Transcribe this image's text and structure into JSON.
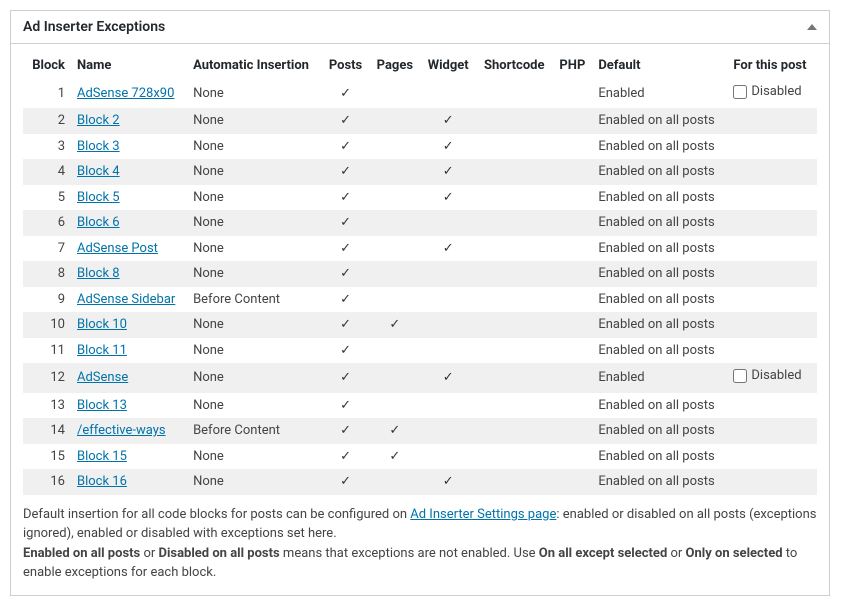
{
  "panel": {
    "title": "Ad Inserter Exceptions"
  },
  "columns": {
    "block": "Block",
    "name": "Name",
    "automatic": "Automatic Insertion",
    "posts": "Posts",
    "pages": "Pages",
    "widget": "Widget",
    "shortcode": "Shortcode",
    "php": "PHP",
    "default": "Default",
    "forpost": "For this post"
  },
  "check": "✓",
  "rows": [
    {
      "n": "1",
      "name": "AdSense 728x90",
      "auto": "None",
      "posts": true,
      "pages": false,
      "widget": false,
      "shortcode": false,
      "php": false,
      "default": "Enabled",
      "disabled": true,
      "disabled_label": "Disabled"
    },
    {
      "n": "2",
      "name": "Block 2",
      "auto": "None",
      "posts": true,
      "pages": false,
      "widget": true,
      "shortcode": false,
      "php": false,
      "default": "Enabled on all posts"
    },
    {
      "n": "3",
      "name": "Block 3",
      "auto": "None",
      "posts": true,
      "pages": false,
      "widget": true,
      "shortcode": false,
      "php": false,
      "default": "Enabled on all posts"
    },
    {
      "n": "4",
      "name": "Block 4",
      "auto": "None",
      "posts": true,
      "pages": false,
      "widget": true,
      "shortcode": false,
      "php": false,
      "default": "Enabled on all posts"
    },
    {
      "n": "5",
      "name": "Block 5",
      "auto": "None",
      "posts": true,
      "pages": false,
      "widget": true,
      "shortcode": false,
      "php": false,
      "default": "Enabled on all posts"
    },
    {
      "n": "6",
      "name": "Block 6",
      "auto": "None",
      "posts": true,
      "pages": false,
      "widget": false,
      "shortcode": false,
      "php": false,
      "default": "Enabled on all posts"
    },
    {
      "n": "7",
      "name": "AdSense Post",
      "auto": "None",
      "posts": true,
      "pages": false,
      "widget": true,
      "shortcode": false,
      "php": false,
      "default": "Enabled on all posts"
    },
    {
      "n": "8",
      "name": "Block 8",
      "auto": "None",
      "posts": true,
      "pages": false,
      "widget": false,
      "shortcode": false,
      "php": false,
      "default": "Enabled on all posts"
    },
    {
      "n": "9",
      "name": "AdSense Sidebar",
      "auto": "Before Content",
      "posts": true,
      "pages": false,
      "widget": false,
      "shortcode": false,
      "php": false,
      "default": "Enabled on all posts"
    },
    {
      "n": "10",
      "name": "Block 10",
      "auto": "None",
      "posts": true,
      "pages": true,
      "widget": false,
      "shortcode": false,
      "php": false,
      "default": "Enabled on all posts"
    },
    {
      "n": "11",
      "name": "Block 11",
      "auto": "None",
      "posts": true,
      "pages": false,
      "widget": false,
      "shortcode": false,
      "php": false,
      "default": "Enabled on all posts"
    },
    {
      "n": "12",
      "name": "AdSense",
      "auto": "None",
      "posts": true,
      "pages": false,
      "widget": true,
      "shortcode": false,
      "php": false,
      "default": "Enabled",
      "disabled": true,
      "disabled_label": "Disabled"
    },
    {
      "n": "13",
      "name": "Block 13",
      "auto": "None",
      "posts": true,
      "pages": false,
      "widget": false,
      "shortcode": false,
      "php": false,
      "default": "Enabled on all posts"
    },
    {
      "n": "14",
      "name": "/effective-ways",
      "auto": "Before Content",
      "posts": true,
      "pages": true,
      "widget": false,
      "shortcode": false,
      "php": false,
      "default": "Enabled on all posts"
    },
    {
      "n": "15",
      "name": "Block 15",
      "auto": "None",
      "posts": true,
      "pages": true,
      "widget": false,
      "shortcode": false,
      "php": false,
      "default": "Enabled on all posts"
    },
    {
      "n": "16",
      "name": "Block 16",
      "auto": "None",
      "posts": true,
      "pages": false,
      "widget": true,
      "shortcode": false,
      "php": false,
      "default": "Enabled on all posts"
    }
  ],
  "footnote": {
    "part1": "Default insertion for all code blocks for posts can be configured on ",
    "link": "Ad Inserter Settings page",
    "part2": ": enabled or disabled on all posts (exceptions ignored), enabled or disabled with exceptions set here.",
    "part3a": "Enabled on all posts",
    "part3b": " or ",
    "part3c": "Disabled on all posts",
    "part3d": " means that exceptions are not enabled. Use ",
    "part3e": "On all except selected",
    "part3f": " or ",
    "part3g": "Only on selected",
    "part3h": " to enable exceptions for each block."
  }
}
